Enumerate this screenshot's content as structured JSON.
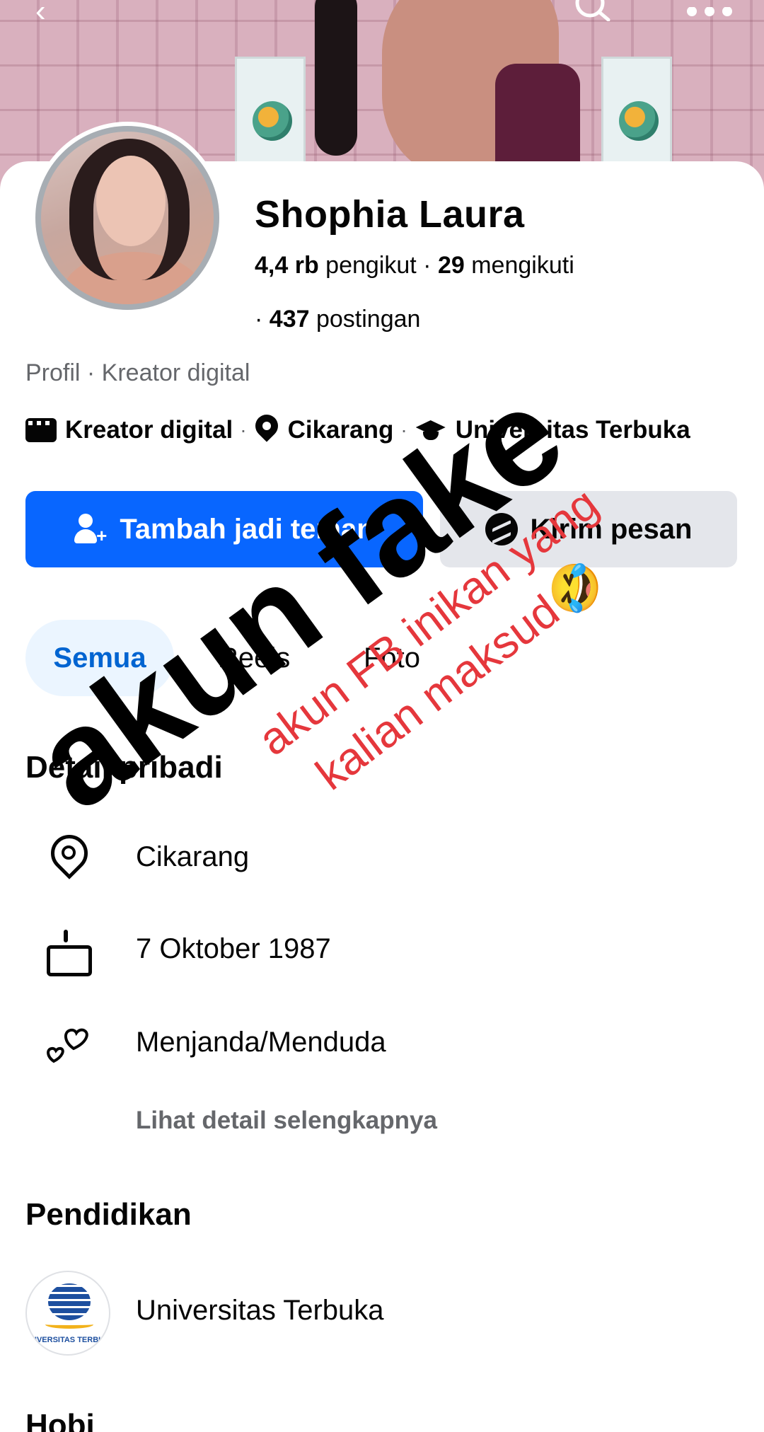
{
  "profile": {
    "name": "Shophia Laura",
    "followers_count": "4,4 rb",
    "followers_label": "pengikut",
    "following_count": "29",
    "following_label": "mengikuti",
    "posts_count": "437",
    "posts_label": "postingan",
    "category_line": "Profil · Kreator digital"
  },
  "intro": {
    "creator": "Kreator digital",
    "location": "Cikarang",
    "school": "Universitas Terbuka",
    "separator": "·"
  },
  "actions": {
    "add_friend": "Tambah jadi teman",
    "message": "Kirim pesan"
  },
  "tabs": [
    "Semua",
    "Reels",
    "Foto"
  ],
  "details": {
    "title": "Detail pribadi",
    "location": "Cikarang",
    "birthday": "7 Oktober 1987",
    "relationship": "Menjanda/Menduda",
    "see_more": "Lihat detail selengkapnya"
  },
  "education": {
    "title": "Pendidikan",
    "school": "Universitas Terbuka",
    "logo_text": "IVERSITAS TERBU"
  },
  "hobbies": {
    "title": "Hobi"
  },
  "overlay": {
    "main_text": "akun fake",
    "red_line1": "akun FB inikan yang",
    "red_line2": "kalian maksud🤣"
  },
  "colors": {
    "primary_blue": "#0866ff",
    "secondary_gray": "#e4e6eb",
    "tab_active_bg": "#ebf5ff",
    "tab_active_text": "#0064d1",
    "overlay_red": "#e5373c"
  },
  "icons": {
    "back": "back-arrow-icon",
    "search": "search-icon",
    "more": "more-icon"
  }
}
